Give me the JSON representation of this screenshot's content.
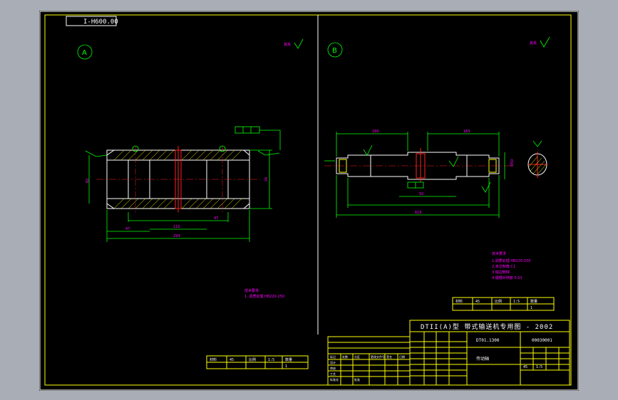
{
  "drawing_code_label": "I-H600.00",
  "view_a_label": "A",
  "view_b_label": "B",
  "roughness_note_left": "其余",
  "roughness_note_right": "其余",
  "tech_notes_left": [
    "技术要求",
    "1. 调质处理 HB220-250"
  ],
  "tech_notes_right": [
    "技术要求",
    "1.调质处理 HB220-250",
    "2.未注倒角 C1",
    "3.锐边倒钝",
    "4.键槽对称度 0.03"
  ],
  "dims_left": {
    "overall": "294",
    "left_seg": "47",
    "mid_seg": "110",
    "right_seg": "47",
    "mid_width": "26",
    "inner_left": "82"
  },
  "dims_right": {
    "overall": "618",
    "left_len": "180",
    "right_len": "165",
    "key_len": "50",
    "dia": "Φ50"
  },
  "title_block": {
    "title": "DTII(A)型 带式输送机专用图 - 2002",
    "code": "DT01-1300",
    "part_no": "00030001",
    "part_name": "传动轴",
    "material": "45",
    "scale": "1:5",
    "rows": [
      "标记",
      "处数",
      "分区",
      "更改文件号",
      "签名",
      "日期"
    ],
    "roles": [
      "设计",
      "审核",
      "工艺",
      "标准化",
      "批准"
    ]
  },
  "small_tables": {
    "left": {
      "h1": "材料",
      "h2": "45",
      "h3": "比例",
      "h4": "1:5",
      "h5": "数量",
      "h6": "1"
    },
    "right": {
      "h1": "材料",
      "h2": "45",
      "h3": "比例",
      "h4": "1:5",
      "h5": "数量",
      "h6": "1"
    }
  },
  "title_small_left": "DT01.1300",
  "title_small_right": "00030001",
  "part_name_label": "传动轴"
}
